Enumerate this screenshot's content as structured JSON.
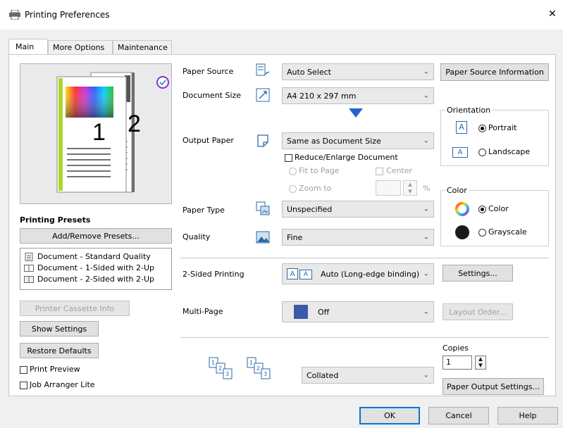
{
  "window": {
    "title": "Printing Preferences",
    "close_glyph": "✕"
  },
  "tabs": [
    {
      "label": "Main",
      "active": true
    },
    {
      "label": "More Options",
      "active": false
    },
    {
      "label": "Maintenance",
      "active": false
    }
  ],
  "preview": {
    "page_left": "1",
    "page_right": "2"
  },
  "presets": {
    "title": "Printing Presets",
    "add_remove_label": "Add/Remove Presets...",
    "items": [
      "Document - Standard Quality",
      "Document - 1-Sided with 2-Up",
      "Document - 2-Sided with 2-Up"
    ]
  },
  "left_buttons": {
    "printer_cassette_info": "Printer Cassette Info",
    "show_settings": "Show Settings",
    "restore_defaults": "Restore Defaults"
  },
  "left_checks": {
    "print_preview": "Print Preview",
    "job_arranger": "Job Arranger Lite"
  },
  "paper_source": {
    "label": "Paper Source",
    "value": "Auto Select",
    "info_button": "Paper Source Information"
  },
  "document_size": {
    "label": "Document Size",
    "value": "A4 210 x 297 mm"
  },
  "output_paper": {
    "label": "Output Paper",
    "value": "Same as Document Size",
    "reduce_enlarge": "Reduce/Enlarge Document",
    "fit_to_page": "Fit to Page",
    "center": "Center",
    "zoom_to": "Zoom to",
    "zoom_unit": "%"
  },
  "orientation": {
    "title": "Orientation",
    "portrait": "Portrait",
    "landscape": "Landscape"
  },
  "paper_type": {
    "label": "Paper Type",
    "value": "Unspecified"
  },
  "quality": {
    "label": "Quality",
    "value": "Fine"
  },
  "color": {
    "title": "Color",
    "color": "Color",
    "grayscale": "Grayscale"
  },
  "two_sided": {
    "label": "2-Sided Printing",
    "value": "Auto (Long-edge binding)",
    "settings_button": "Settings..."
  },
  "multi_page": {
    "label": "Multi-Page",
    "value": "Off",
    "layout_order_button": "Layout Order..."
  },
  "collate": {
    "value": "Collated"
  },
  "copies": {
    "label": "Copies",
    "value": "1",
    "output_settings_button": "Paper Output Settings..."
  },
  "footer": {
    "ok": "OK",
    "cancel": "Cancel",
    "help": "Help"
  },
  "colors": {
    "accent": "#0078d7",
    "arrow_blue": "#2266cc",
    "multipage_blue": "#3a5ba8"
  }
}
